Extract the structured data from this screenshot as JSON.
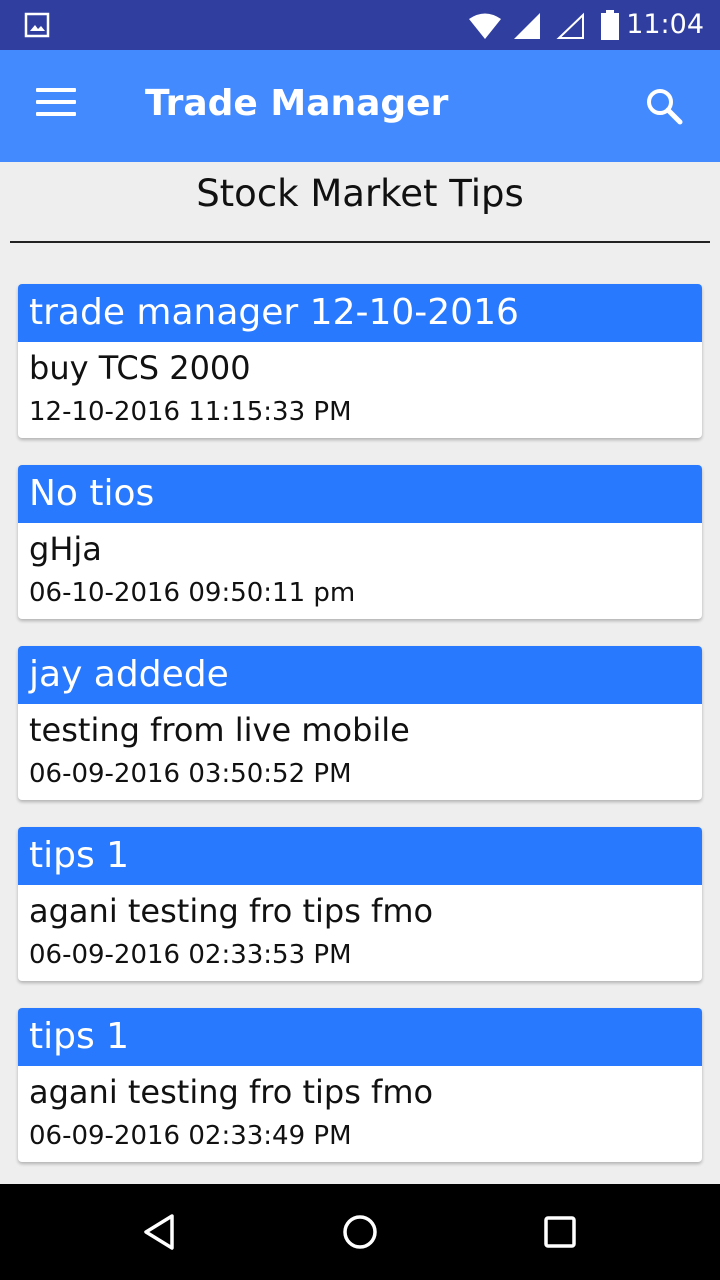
{
  "status_bar": {
    "time": "11:04",
    "icons": [
      "image-icon",
      "wifi-icon",
      "signal-icon",
      "signal-empty-icon",
      "battery-icon"
    ]
  },
  "app_bar": {
    "title": "Trade Manager",
    "menu_icon": "hamburger-menu-icon",
    "search_icon": "search-icon",
    "color": "#448aff"
  },
  "page": {
    "title": "Stock Market Tips"
  },
  "tips": [
    {
      "title": "trade manager 12-10-2016",
      "body": "buy TCS 2000",
      "date": "12-10-2016 11:15:33 PM"
    },
    {
      "title": "No tios",
      "body": "gHja",
      "date": "06-10-2016 09:50:11 pm"
    },
    {
      "title": "jay addede",
      "body": "testing from live mobile",
      "date": "06-09-2016 03:50:52 PM"
    },
    {
      "title": "tips 1",
      "body": "agani testing fro tips fmo",
      "date": "06-09-2016 02:33:53 PM"
    },
    {
      "title": "tips 1",
      "body": "agani testing fro tips fmo",
      "date": "06-09-2016 02:33:49 PM"
    }
  ],
  "colors": {
    "status_bar": "#303f9f",
    "card_header": "#2979ff",
    "background": "#eeeeee"
  },
  "nav_bar": {
    "icons": [
      "back-icon",
      "home-icon",
      "recents-icon"
    ]
  }
}
